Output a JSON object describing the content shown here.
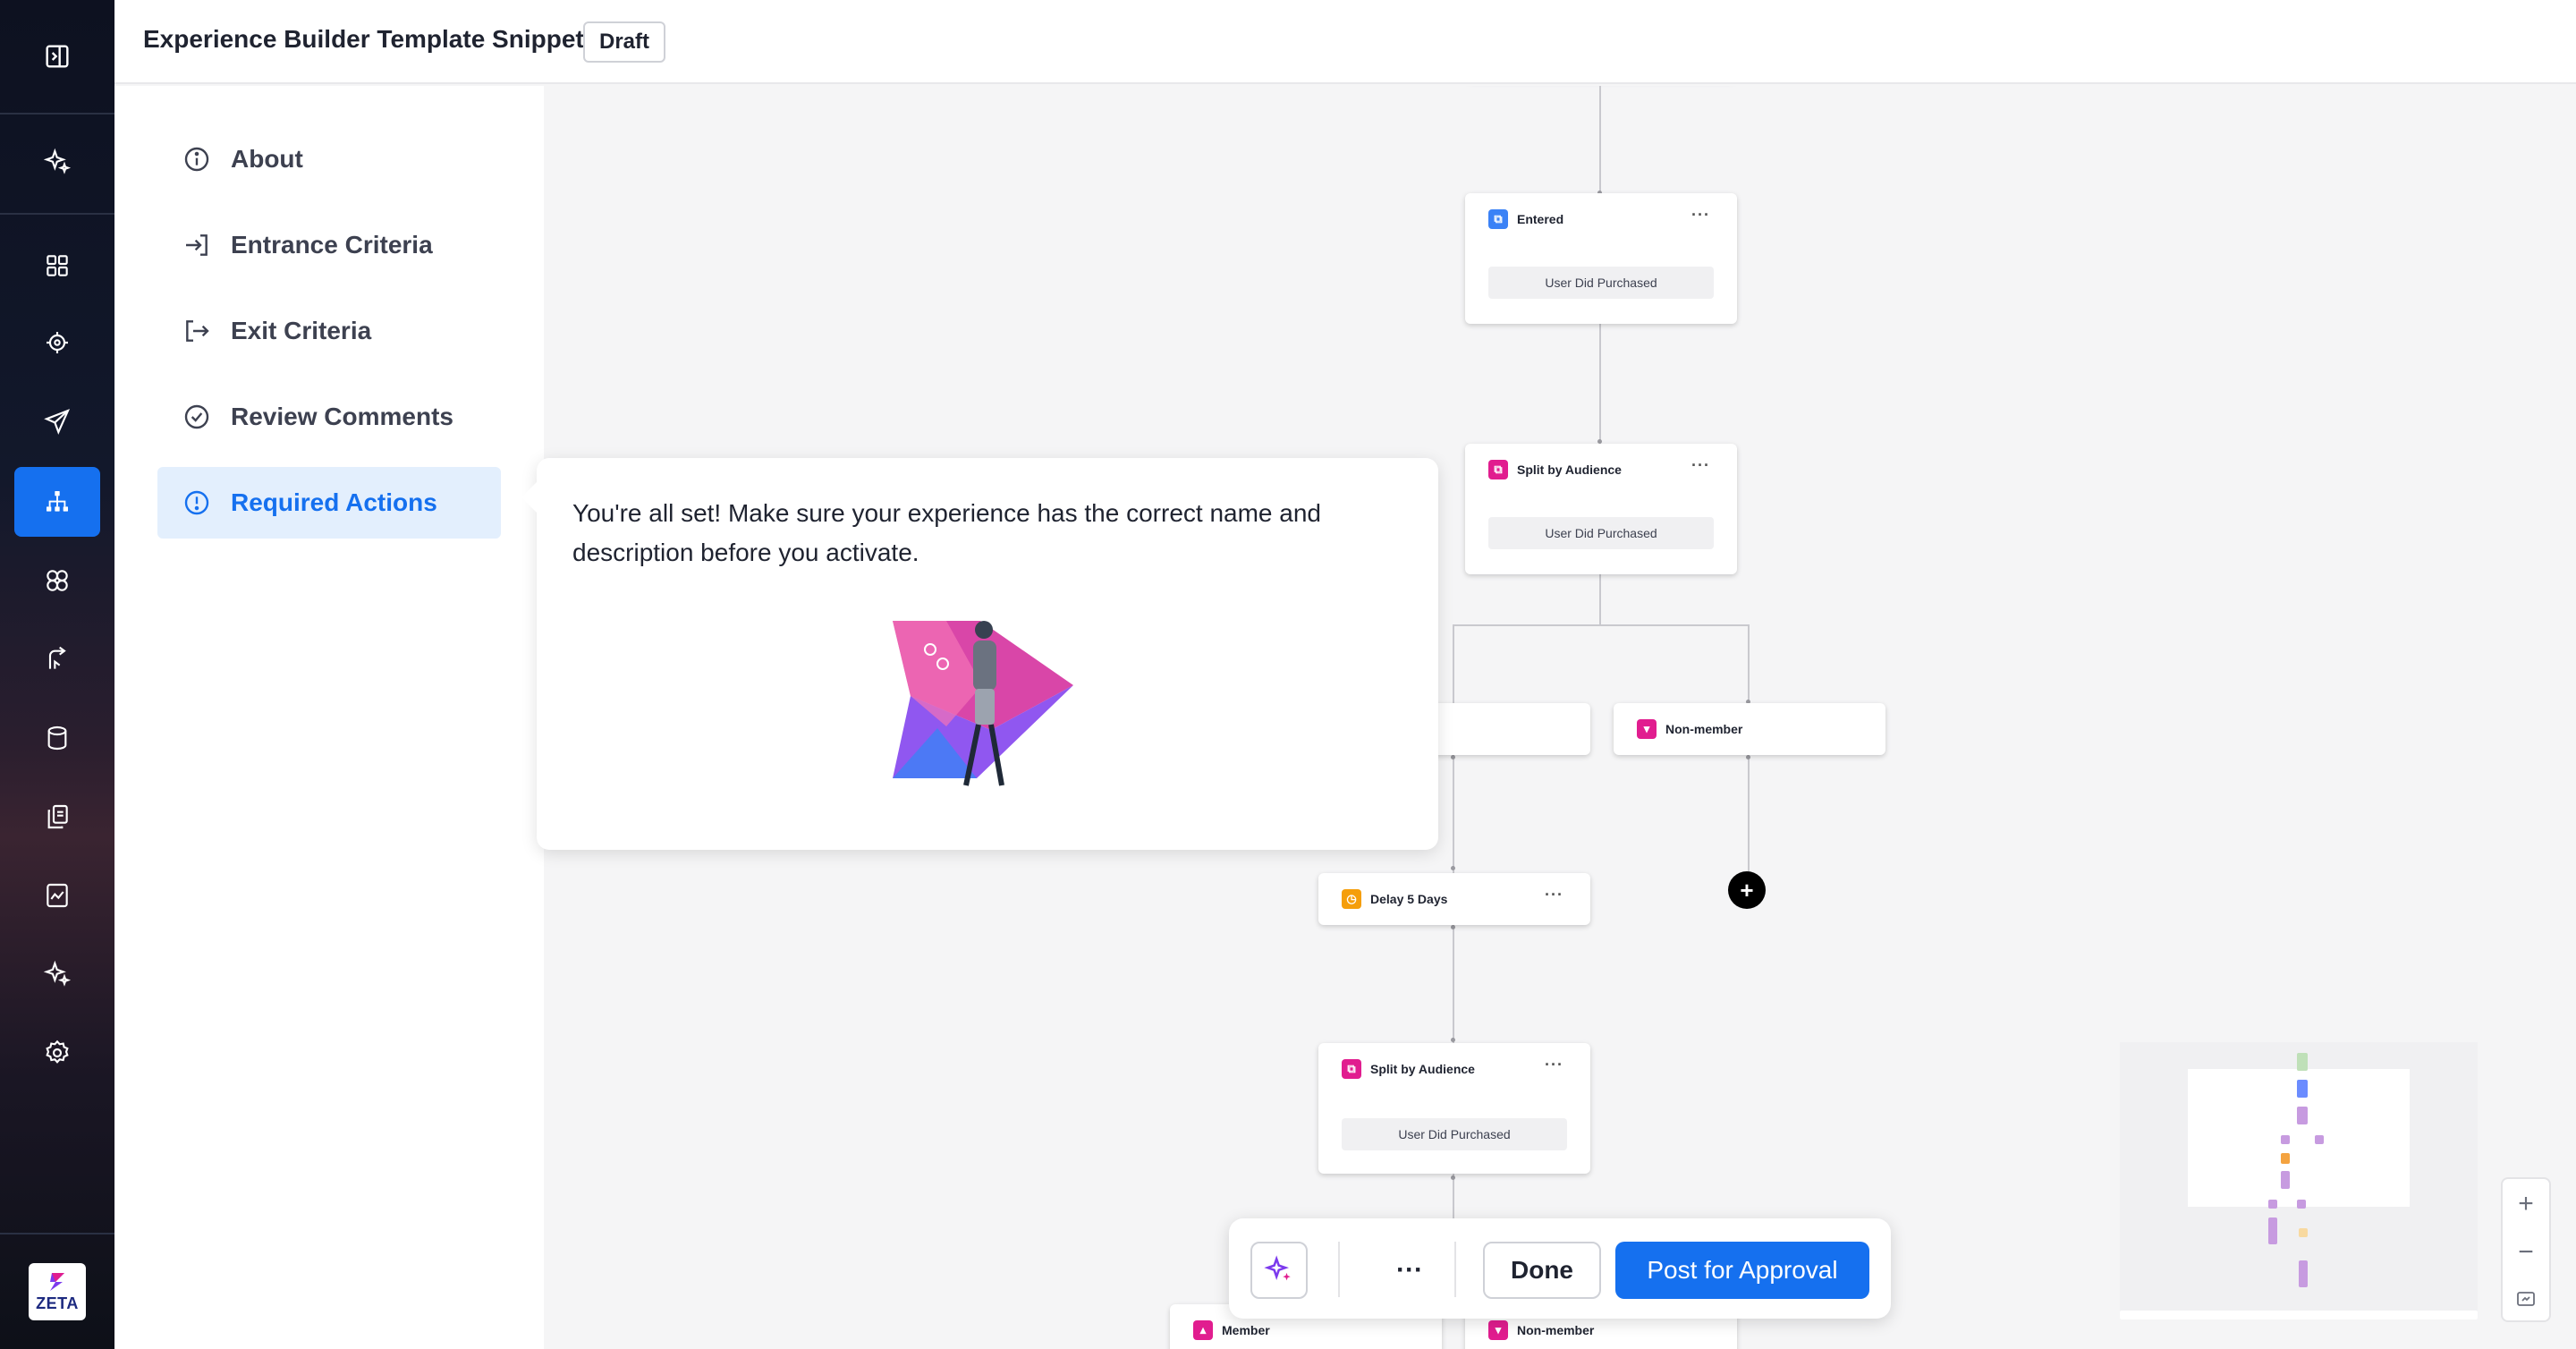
{
  "header": {
    "title": "Experience Builder Template Snippets",
    "status_badge": "Draft"
  },
  "rail": {
    "items": [
      {
        "icon": "collapse-panel-icon"
      },
      {
        "icon": "sparkle-icon"
      },
      {
        "icon": "dashboard-grid-icon"
      },
      {
        "icon": "target-icon"
      },
      {
        "icon": "send-icon"
      },
      {
        "icon": "journey-tree-icon",
        "active": true
      },
      {
        "icon": "audience-circles-icon"
      },
      {
        "icon": "handoff-icon"
      },
      {
        "icon": "database-icon"
      },
      {
        "icon": "content-copy-icon"
      },
      {
        "icon": "analytics-icon"
      },
      {
        "icon": "sparkle-icon"
      },
      {
        "icon": "settings-gear-icon"
      }
    ],
    "logo_text": "ZETA"
  },
  "sidenav": {
    "items": [
      {
        "label": "About",
        "icon": "info-circle-icon"
      },
      {
        "label": "Entrance Criteria",
        "icon": "enter-arrow-icon"
      },
      {
        "label": "Exit Criteria",
        "icon": "exit-arrow-icon"
      },
      {
        "label": "Review Comments",
        "icon": "check-circle-icon"
      },
      {
        "label": "Required Actions",
        "icon": "alert-circle-icon",
        "active": true
      }
    ]
  },
  "popover": {
    "message": "You're all set! Make sure your experience has the correct name and description before you activate."
  },
  "canvas": {
    "nodes": {
      "entered": {
        "title": "Entered",
        "condition": "User Did Purchased"
      },
      "split1": {
        "title": "Split by Audience",
        "condition": "User Did Purchased"
      },
      "nonmember1": {
        "title": "Non-member"
      },
      "delay": {
        "title": "Delay 5 Days"
      },
      "split2": {
        "title": "Split by Audience",
        "condition": "User Did Purchased"
      },
      "member": {
        "title": "Member"
      },
      "nonmember2": {
        "title": "Non-member"
      }
    },
    "more_label": "···",
    "add_label": "+"
  },
  "zoom": {
    "in": "+",
    "out": "−"
  },
  "actionbar": {
    "more": "···",
    "done": "Done",
    "post": "Post for Approval"
  },
  "colors": {
    "primary": "#1570ef",
    "audience": "#e11d8f",
    "entry": "#3b82f6",
    "delay": "#f59e0b"
  }
}
